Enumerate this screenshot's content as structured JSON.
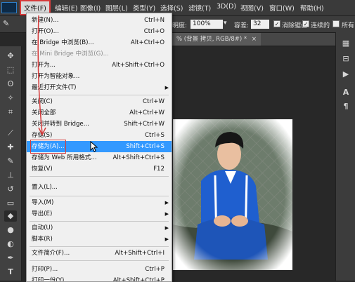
{
  "menubar": {
    "items": [
      {
        "label": "文件(F)",
        "active": true
      },
      {
        "label": "编辑(E)"
      },
      {
        "label": "图像(I)"
      },
      {
        "label": "图层(L)"
      },
      {
        "label": "类型(Y)"
      },
      {
        "label": "选择(S)"
      },
      {
        "label": "滤镜(T)"
      },
      {
        "label": "3D(D)"
      },
      {
        "label": "视图(V)"
      },
      {
        "label": "窗口(W)"
      },
      {
        "label": "帮助(H)"
      }
    ]
  },
  "options": {
    "opacity_label": "明度:",
    "opacity_value": "100%",
    "tolerance_label": "容差:",
    "tolerance_value": "32",
    "antialias_label": "消除锯齿",
    "contiguous_label": "连续的",
    "all_label": "所有"
  },
  "document_tab": {
    "title": "% (背景 拷贝, RGB/8#) *",
    "close": "×"
  },
  "file_menu": {
    "items": [
      {
        "label": "新建(N)...",
        "shortcut": "Ctrl+N"
      },
      {
        "label": "打开(O)...",
        "shortcut": "Ctrl+O"
      },
      {
        "label": "在 Bridge 中浏览(B)...",
        "shortcut": "Alt+Ctrl+O"
      },
      {
        "label": "在 Mini Bridge 中浏览(G)...",
        "shortcut": "",
        "disabled": true
      },
      {
        "label": "打开为...",
        "shortcut": "Alt+Shift+Ctrl+O"
      },
      {
        "label": "打开为智能对象...",
        "shortcut": ""
      },
      {
        "label": "最近打开文件(T)",
        "shortcut": "",
        "submenu": true
      },
      {
        "label": "关闭(C)",
        "shortcut": "Ctrl+W"
      },
      {
        "label": "关闭全部",
        "shortcut": "Alt+Ctrl+W"
      },
      {
        "label": "关闭并转到 Bridge...",
        "shortcut": "Shift+Ctrl+W"
      },
      {
        "label": "存储(S)",
        "shortcut": "Ctrl+S"
      },
      {
        "label": "存储为(A)...",
        "shortcut": "Shift+Ctrl+S",
        "highlighted": true
      },
      {
        "label": "存储为 Web 所用格式...",
        "shortcut": "Alt+Shift+Ctrl+S"
      },
      {
        "label": "恢复(V)",
        "shortcut": "F12"
      },
      {
        "label": "置入(L)...",
        "shortcut": ""
      },
      {
        "label": "导入(M)",
        "shortcut": "",
        "submenu": true
      },
      {
        "label": "导出(E)",
        "shortcut": "",
        "submenu": true
      },
      {
        "label": "自动(U)",
        "shortcut": "",
        "submenu": true
      },
      {
        "label": "脚本(R)",
        "shortcut": "",
        "submenu": true
      },
      {
        "label": "文件简介(F)...",
        "shortcut": "Alt+Shift+Ctrl+I"
      },
      {
        "label": "打印(P)...",
        "shortcut": "Ctrl+P"
      },
      {
        "label": "打印一份(Y)",
        "shortcut": "Alt+Shift+Ctrl+P"
      }
    ],
    "submenu_arrow": "▶"
  },
  "right_panel": {
    "text_tool_label": "A",
    "paragraph_label": "¶"
  },
  "toolbar": {
    "type_tool_label": "T"
  },
  "colors": {
    "highlight": "#3399ff",
    "annotation_red": "#d63b3b",
    "menu_bg": "#f0f0f0",
    "app_bg": "#282828"
  }
}
